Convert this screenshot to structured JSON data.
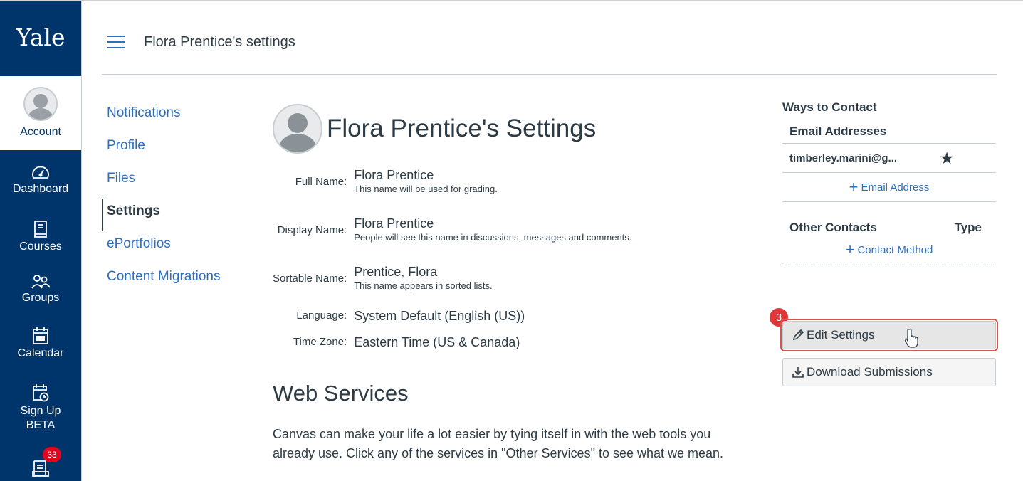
{
  "brand": {
    "logo_text": "Yale"
  },
  "global_nav": {
    "account": "Account",
    "dashboard": "Dashboard",
    "courses": "Courses",
    "groups": "Groups",
    "calendar": "Calendar",
    "signup_line1": "Sign Up",
    "signup_line2": "BETA",
    "inbox_badge": "33"
  },
  "header": {
    "title": "Flora Prentice's settings"
  },
  "subnav": {
    "items": [
      "Notifications",
      "Profile",
      "Files",
      "Settings",
      "ePortfolios",
      "Content Migrations"
    ],
    "active": "Settings"
  },
  "main": {
    "page_title": "Flora Prentice's Settings",
    "fields": {
      "full_name_label": "Full Name:",
      "full_name_value": "Flora Prentice",
      "full_name_hint": "This name will be used for grading.",
      "display_name_label": "Display Name:",
      "display_name_value": "Flora Prentice",
      "display_name_hint": "People will see this name in discussions, messages and comments.",
      "sortable_name_label": "Sortable Name:",
      "sortable_name_value": "Prentice, Flora",
      "sortable_name_hint": "This name appears in sorted lists.",
      "language_label": "Language:",
      "language_value": "System Default (English (US))",
      "timezone_label": "Time Zone:",
      "timezone_value": "Eastern Time (US & Canada)"
    },
    "web_services_title": "Web Services",
    "web_services_text": "Canvas can make your life a lot easier by tying itself in with the web tools you already use. Click any of the services in \"Other Services\" to see what we mean."
  },
  "sidebar": {
    "ways_title": "Ways to Contact",
    "email_head": "Email Addresses",
    "email_value": "timberley.marini@g...",
    "add_email": "Email Address",
    "other_contacts": "Other Contacts",
    "type_col": "Type",
    "add_contact": "Contact Method",
    "edit_settings": "Edit Settings",
    "download_submissions": "Download Submissions",
    "step_badge": "3"
  },
  "colors": {
    "nav_bg": "#00356b",
    "link": "#2d6ebd",
    "highlight": "#d9534f",
    "badge": "#e0061f"
  }
}
